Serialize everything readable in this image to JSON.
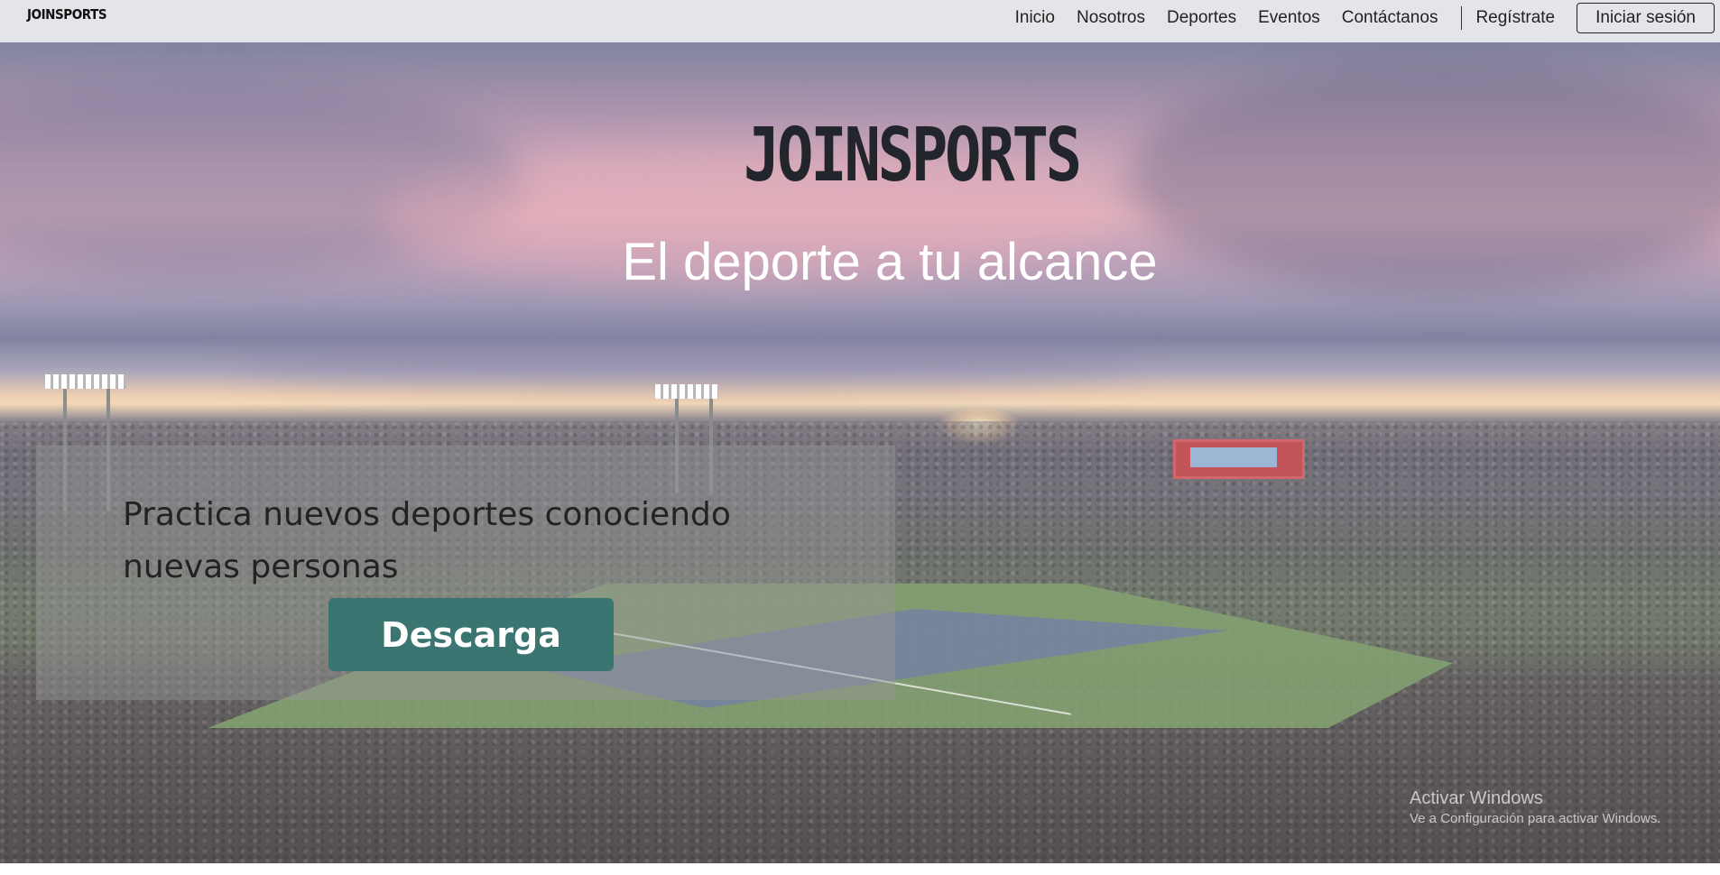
{
  "navbar": {
    "brand": "JOINSPORTS",
    "links": [
      "Inicio",
      "Nosotros",
      "Deportes",
      "Eventos",
      "Contáctanos"
    ],
    "register_label": "Regístrate",
    "login_label": "Iniciar sesión"
  },
  "hero": {
    "logo_text": "JOINSPORTS",
    "tagline": "El deporte a tu alcance",
    "cta_text": "Practica nuevos deportes conociendo nuevas personas",
    "cta_button_label": "Descarga",
    "cta_button_color": "#3a7572"
  },
  "watermark": {
    "title": "Activar Windows",
    "subtitle": "Ve a Configuración para activar Windows."
  }
}
